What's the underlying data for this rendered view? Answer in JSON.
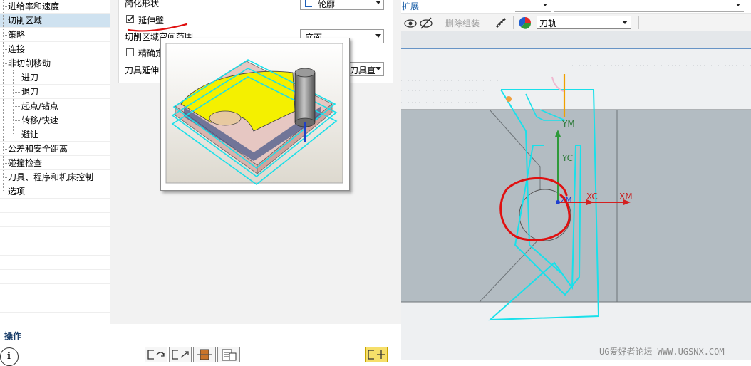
{
  "tree": {
    "items": [
      {
        "label": "进给率和速度",
        "indent": 0,
        "selected": false
      },
      {
        "label": "切削区域",
        "indent": 0,
        "selected": true
      },
      {
        "label": "策略",
        "indent": 0,
        "selected": false
      },
      {
        "label": "连接",
        "indent": 0,
        "selected": false
      },
      {
        "label": "非切削移动",
        "indent": 0,
        "selected": false
      },
      {
        "label": "进刀",
        "indent": 1,
        "selected": false
      },
      {
        "label": "退刀",
        "indent": 1,
        "selected": false
      },
      {
        "label": "起点/钻点",
        "indent": 1,
        "selected": false
      },
      {
        "label": "转移/快速",
        "indent": 1,
        "selected": false
      },
      {
        "label": "避让",
        "indent": 1,
        "selected": false
      },
      {
        "label": "公差和安全距离",
        "indent": 0,
        "selected": false
      },
      {
        "label": "碰撞检查",
        "indent": 0,
        "selected": false
      },
      {
        "label": "刀具、程序和机床控制",
        "indent": 0,
        "selected": false
      },
      {
        "label": "选项",
        "indent": 0,
        "selected": false
      }
    ]
  },
  "params": {
    "simplify_shape_label": "简化形状",
    "simplify_shape_value": "轮廓",
    "extend_wall_label": "延伸壁",
    "extend_wall_checked": true,
    "cut_region_space_label": "切削区域空间范围",
    "cut_region_space_value": "底面",
    "precise_label": "精确定",
    "precise_checked": false,
    "tool_extend_label": "刀具延伸",
    "tool_extend_value": "刀具直"
  },
  "operations": {
    "title": "操作"
  },
  "graphics": {
    "top_combo_value": "扩展",
    "toolbar": {
      "delete_assembly": "删除组装",
      "color_mode_value": "刀轨"
    },
    "axes": {
      "ym": "YM",
      "yc": "YC",
      "xc": "XC",
      "xm": "XM",
      "zm": "ZM"
    },
    "watermark": "UG爱好者论坛 WWW.UGSNX.COM"
  },
  "colors": {
    "selection": "#cfe2f0",
    "toolpath": "#19e0ea",
    "viewport_bg": "#b3bcc2",
    "highlight_annotation": "#e01010",
    "axis_x": "#d42020",
    "axis_y": "#2e9a3a",
    "yellow_part": "#f4f000"
  }
}
